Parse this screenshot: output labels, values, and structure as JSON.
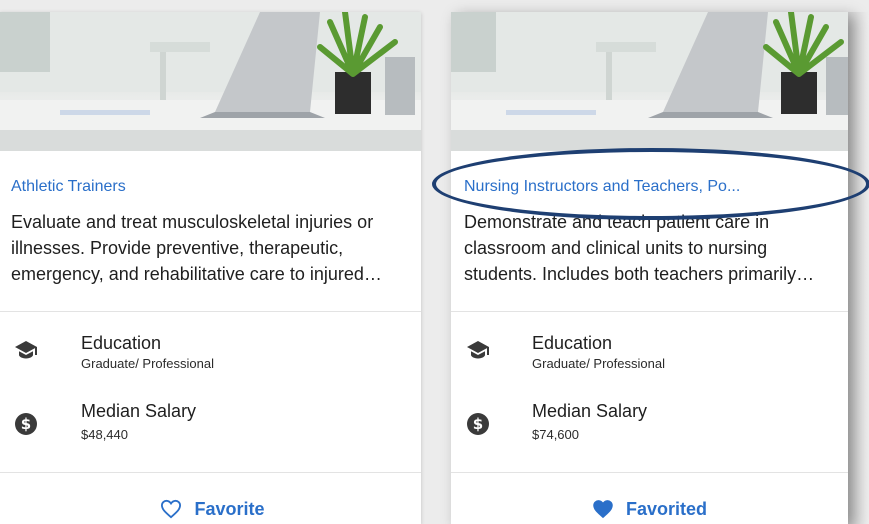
{
  "cards": [
    {
      "title": "Athletic Trainers",
      "description": "Evaluate and treat musculoskeletal injuries or illnesses. Provide preventive, therapeutic, emergency, and rehabilitative care to injured athletes.",
      "education_label": "Education",
      "education_value": "Graduate/ Professional",
      "salary_label": "Median Salary",
      "salary_value": "$48,440",
      "favorite_label": "Favorite",
      "favorite_icon": "heart-outline-icon",
      "favorited": false
    },
    {
      "title": "Nursing Instructors and Teachers, Po...",
      "description": "Demonstrate and teach patient care in classroom and clinical units to nursing students. Includes both teachers primarily engaged in teaching and those who do a combination.",
      "education_label": "Education",
      "education_value": "Graduate/ Professional",
      "salary_label": "Median Salary",
      "salary_value": "$74,600",
      "favorite_label": "Favorited",
      "favorite_icon": "heart-filled-icon",
      "favorited": true
    }
  ],
  "icons": {
    "education": "graduation-cap-icon",
    "salary": "dollar-circle-icon"
  },
  "colors": {
    "link": "#2a6fc9",
    "highlight_oval": "#1e3f72"
  }
}
